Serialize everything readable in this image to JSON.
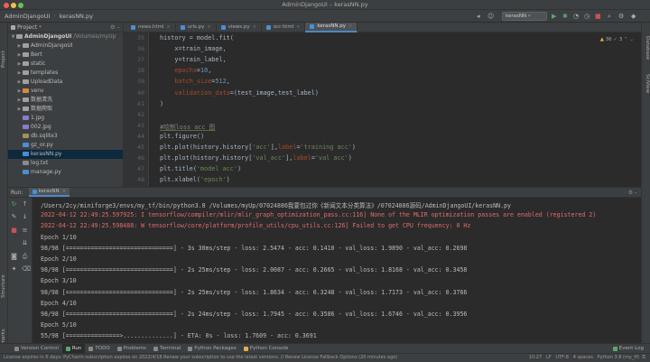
{
  "window": {
    "title": "AdminDjangoUI – kerasNN.py"
  },
  "navbar": {
    "breadcrumbs": [
      "AdminDjangoUI",
      "kerasNN.py"
    ],
    "run_config": "kerasNN"
  },
  "sidebar_left": {
    "project_label": "Project",
    "structure_label": "Structure",
    "bookmarks_label": "Bookmarks"
  },
  "sidebar_right": {
    "database_label": "Database",
    "sciview_label": "SciView"
  },
  "project_panel": {
    "header": "Project",
    "root_name": "AdminDjangoUI",
    "root_path": "/Volumes/myUp",
    "items": [
      {
        "label": "AdminDjangoUI",
        "kind": "folder"
      },
      {
        "label": "Bert",
        "kind": "folder"
      },
      {
        "label": "static",
        "kind": "folder"
      },
      {
        "label": "templates",
        "kind": "folder"
      },
      {
        "label": "UploadData",
        "kind": "folder"
      },
      {
        "label": "venv",
        "kind": "folder-orange"
      },
      {
        "label": "数据清洗",
        "kind": "folder"
      },
      {
        "label": "数据爬取",
        "kind": "folder"
      },
      {
        "label": "1.jpg",
        "kind": "image"
      },
      {
        "label": "002.jpg",
        "kind": "image"
      },
      {
        "label": "db.sqlite3",
        "kind": "db"
      },
      {
        "label": "gz_or.py",
        "kind": "py"
      },
      {
        "label": "kerasNN.py",
        "kind": "py"
      },
      {
        "label": "log.txt",
        "kind": "txt"
      },
      {
        "label": "manage.py",
        "kind": "py"
      }
    ]
  },
  "editor_tabs": [
    {
      "label": "news.html",
      "active": false
    },
    {
      "label": "urls.py",
      "active": false
    },
    {
      "label": "views.py",
      "active": false
    },
    {
      "label": "ocr.html",
      "active": false
    },
    {
      "label": "kerasNN.py",
      "active": true
    }
  ],
  "editor": {
    "inspection_warnings": "36",
    "inspection_weak": "3",
    "lines": [
      {
        "n": "35",
        "parts": [
          [
            "t",
            "history = model.fit("
          ]
        ]
      },
      {
        "n": "36",
        "parts": [
          [
            "t",
            "    x=train_image,"
          ]
        ]
      },
      {
        "n": "37",
        "parts": [
          [
            "t",
            "    y=train_label,"
          ]
        ]
      },
      {
        "n": "38",
        "parts": [
          [
            "k",
            "    epochs"
          ],
          [
            "t",
            "="
          ],
          [
            "num",
            "10"
          ],
          [
            "t",
            ","
          ]
        ]
      },
      {
        "n": "39",
        "parts": [
          [
            "k",
            "    batch_size"
          ],
          [
            "t",
            "="
          ],
          [
            "num",
            "512"
          ],
          [
            "t",
            ","
          ]
        ]
      },
      {
        "n": "40",
        "parts": [
          [
            "k",
            "    validation_data"
          ],
          [
            "t",
            "=(test_image,test_label)"
          ]
        ]
      },
      {
        "n": "41",
        "parts": [
          [
            "t",
            ")"
          ]
        ]
      },
      {
        "n": "42",
        "parts": [
          [
            "t",
            ""
          ]
        ]
      },
      {
        "n": "43",
        "parts": [
          [
            "c",
            "#绘制loss acc 图"
          ]
        ]
      },
      {
        "n": "44",
        "parts": [
          [
            "t",
            "plt.figure()"
          ]
        ]
      },
      {
        "n": "45",
        "parts": [
          [
            "t",
            "plt.plot(history.history["
          ],
          [
            "s",
            "'acc'"
          ],
          [
            "t",
            "],"
          ],
          [
            "k",
            "label"
          ],
          [
            "t",
            "="
          ],
          [
            "s",
            "'training acc'"
          ],
          [
            "t",
            ")"
          ]
        ]
      },
      {
        "n": "46",
        "parts": [
          [
            "t",
            "plt.plot(history.history["
          ],
          [
            "s",
            "'val_acc'"
          ],
          [
            "t",
            "],"
          ],
          [
            "k",
            "label"
          ],
          [
            "t",
            "="
          ],
          [
            "s",
            "'val acc'"
          ],
          [
            "t",
            ")"
          ]
        ]
      },
      {
        "n": "47",
        "parts": [
          [
            "t",
            "plt.title("
          ],
          [
            "s",
            "'model acc'"
          ],
          [
            "t",
            ")"
          ]
        ]
      },
      {
        "n": "48",
        "parts": [
          [
            "t",
            "plt.xlabel("
          ],
          [
            "s",
            "'epoch'"
          ],
          [
            "t",
            ")"
          ]
        ]
      }
    ]
  },
  "run_panel": {
    "label": "Run:",
    "tab_label": "kerasNN",
    "console": [
      {
        "text": "/Users/2cy/miniforge3/envs/my_tf/bin/python3.8 /Volumes/myUp/07024886我要包过你《新闻文本分类算法》/07024886源码/AdminDjangoUI/kerasNN.py",
        "err": false
      },
      {
        "text": "2022-04-12 22:49:25.597925: I tensorflow/compiler/mlir/mlir_graph_optimization_pass.cc:116] None of the MLIR optimization passes are enabled (registered 2)",
        "err": true
      },
      {
        "text": "2022-04-12 22:49:25.598488: W tensorflow/core/platform/profile_utils/cpu_utils.cc:126] Failed to get CPU frequency: 0 Hz",
        "err": true
      },
      {
        "text": "Epoch 1/10",
        "err": false
      },
      {
        "text": "98/98 [==============================] - 3s 30ms/step - loss: 2.5474 - acc: 0.1410 - val_loss: 1.9890 - val_acc: 0.2698",
        "err": false
      },
      {
        "text": "Epoch 2/10",
        "err": false
      },
      {
        "text": "98/98 [==============================] - 2s 25ms/step - loss: 2.0087 - acc: 0.2665 - val_loss: 1.8168 - val_acc: 0.3458",
        "err": false
      },
      {
        "text": "Epoch 3/10",
        "err": false
      },
      {
        "text": "98/98 [==============================] - 2s 25ms/step - loss: 1.8634 - acc: 0.3248 - val_loss: 1.7173 - val_acc: 0.3766",
        "err": false
      },
      {
        "text": "Epoch 4/10",
        "err": false
      },
      {
        "text": "98/98 [==============================] - 2s 24ms/step - loss: 1.7945 - acc: 0.3586 - val_loss: 1.6746 - val_acc: 0.3956",
        "err": false
      },
      {
        "text": "Epoch 5/10",
        "err": false
      },
      {
        "text": "55/98 [===============>..............] - ETA: 0s - loss: 1.7609 - acc: 0.3691",
        "err": false
      }
    ]
  },
  "tool_windows": [
    {
      "label": "Version Control",
      "active": false
    },
    {
      "label": "Run",
      "active": true
    },
    {
      "label": "TODO",
      "active": false
    },
    {
      "label": "Problems",
      "active": false
    },
    {
      "label": "Terminal",
      "active": false
    },
    {
      "label": "Python Packages",
      "active": false
    },
    {
      "label": "Python Console",
      "active": false
    }
  ],
  "event_log": "Event Log",
  "status": {
    "message": "License expires in 6 days: PyCharm subscription expires on 2022/4/18.Renew your subscription to use the latest versions. // Renew License   Fallback Options (20 minutes ago)",
    "position": "10:27",
    "line_sep": "LF",
    "encoding": "UTF-8",
    "indent": "4 spaces",
    "interpreter": "Python 3.8 (my_tf)"
  },
  "colors": {
    "accent": "#4a88c7",
    "error": "#e06c6c",
    "keyword": "#aa4926",
    "string": "#6a8759",
    "number": "#6897bb"
  }
}
